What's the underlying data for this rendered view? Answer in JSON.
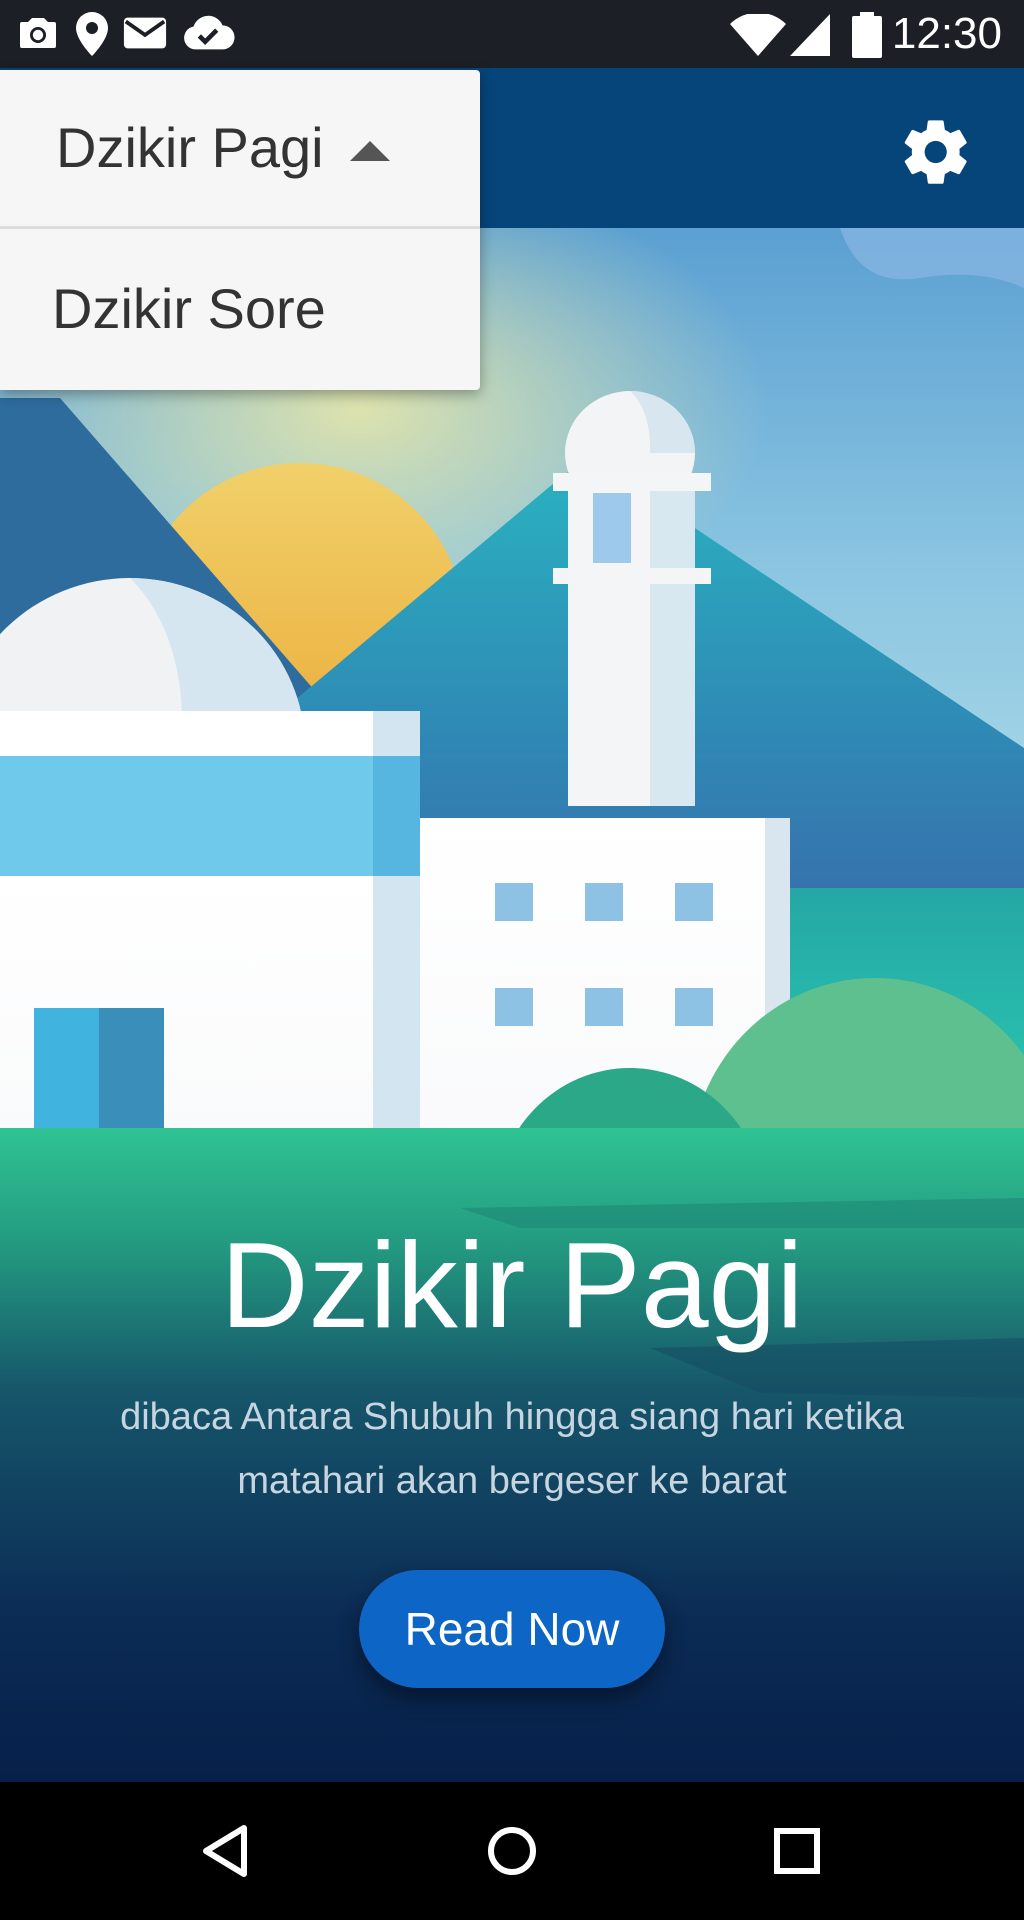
{
  "status_bar": {
    "time": "12:30",
    "left_icons": [
      "camera-icon",
      "location-pin-icon",
      "mail-icon",
      "cloud-check-icon"
    ],
    "right_icons": [
      "wifi-icon",
      "signal-icon",
      "battery-icon"
    ]
  },
  "dropdown": {
    "selected": "Dzikir Pagi",
    "options": [
      {
        "label": "Dzikir Sore"
      }
    ]
  },
  "app_bar": {
    "settings_icon": "gear-icon"
  },
  "hero": {
    "title": "Dzikir Pagi",
    "description": "dibaca Antara Shubuh hingga siang hari ketika matahari akan bergeser ke barat",
    "button_label": "Read Now"
  },
  "nav_bar": {
    "buttons": [
      "back-icon",
      "home-icon",
      "recents-icon"
    ]
  },
  "colors": {
    "app_bar": "#06457a",
    "button": "#0d65c6",
    "status_bar": "#1c1f26"
  }
}
